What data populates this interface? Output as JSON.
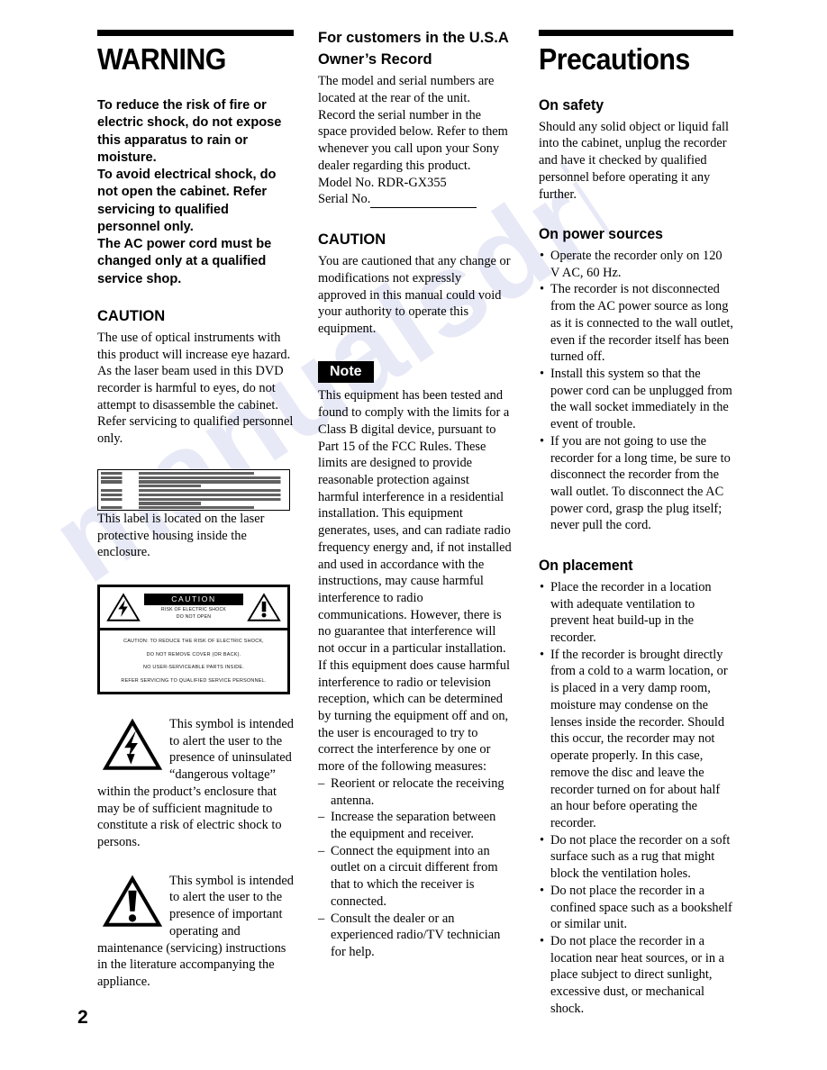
{
  "page": {
    "number": "2",
    "watermark_text": "manualsdrive.com"
  },
  "left_column": {
    "heading": "WARNING",
    "warning_paragraphs": [
      "To reduce the risk of fire or electric shock, do not expose this apparatus to rain or moisture.",
      "To avoid electrical shock, do not open the cabinet. Refer servicing to qualified personnel only.",
      "The AC power cord must be changed only at a qualified service shop."
    ],
    "caution_heading": "CAUTION",
    "caution_text": "The use of optical instruments with this product will increase eye hazard. As the laser beam used in this DVD recorder is harmful to eyes, do not attempt to disassemble the cabinet. Refer servicing to qualified personnel only.",
    "laser_label": {
      "left_terms": [
        "DANGER",
        "CAUTION",
        "VORSICHT",
        "ADVARSEL",
        "VARNING",
        "VARO!",
        "VARO!"
      ],
      "note": "Multilingual laser radiation warning label (text not legible at this resolution)"
    },
    "label_caption": "This label is located on the laser protective housing inside the enclosure.",
    "shock_box": {
      "caution_bar": "CAUTION",
      "caution_sub_line1": "RISK OF ELECTRIC SHOCK",
      "caution_sub_line2": "DO NOT OPEN",
      "lines": [
        "CAUTION: TO REDUCE THE RISK OF ELECTRIC SHOCK,",
        "DO NOT REMOVE COVER (OR BACK).",
        "NO USER-SERVICEABLE PARTS INSIDE.",
        "REFER SERVICING TO QUALIFIED SERVICE PERSONNEL."
      ]
    },
    "symbol_bolt_text": "This symbol is intended to alert the user to the presence of uninsulated “dangerous voltage” within the product’s enclosure that may be of sufficient magnitude to constitute a risk of electric shock to persons.",
    "symbol_excl_text": "This symbol is intended to alert the user to the presence of important operating and maintenance (servicing) instructions in the literature accompanying the appliance."
  },
  "middle_column": {
    "usa_heading_line1": "For customers in the U.S.A",
    "usa_heading_line2": "Owner’s Record",
    "owner_paragraphs": [
      "The model and serial numbers are located at the rear of the unit.",
      "Record the serial number in the space provided below. Refer to them whenever you call upon your Sony dealer regarding this product."
    ],
    "model_label": "Model No. RDR-GX355",
    "serial_label": "Serial No.",
    "caution_heading": "CAUTION",
    "caution_text": "You are cautioned that any change or modifications not expressly approved in this manual could void your authority to operate this equipment.",
    "note_badge": "Note",
    "note_text": "This equipment has been tested and found to comply with the limits for a Class B digital device, pursuant to Part 15 of the FCC Rules. These limits are designed to provide reasonable protection against harmful interference in a residential installation. This equipment generates, uses, and can radiate radio frequency energy and, if not installed and used in accordance with the instructions, may cause harmful interference to radio communications. However, there is no guarantee that interference will not occur in a particular installation. If this equipment does cause harmful interference to radio or television reception, which can be determined by turning the equipment off and on, the user is encouraged to try to correct the interference by one or more of the following measures:",
    "measures": [
      "Reorient or relocate the receiving antenna.",
      "Increase the separation between the equipment and receiver.",
      "Connect the equipment into an outlet on a circuit different from that to which the receiver is connected.",
      "Consult the dealer or an experienced radio/TV technician for help."
    ]
  },
  "right_column": {
    "heading": "Precautions",
    "on_safety": {
      "heading": "On safety",
      "text": "Should any solid object or liquid fall into the cabinet, unplug the recorder and have it checked by qualified personnel before operating it any further."
    },
    "on_power_sources": {
      "heading": "On power sources",
      "bullets": [
        "Operate the recorder only on 120 V AC, 60 Hz.",
        "The recorder is not disconnected from the AC power source as long as it is connected to the wall outlet, even if the recorder itself has been turned off.",
        "Install this system so that the power cord can be unplugged from the wall socket immediately in the event of trouble.",
        "If you are not going to use the recorder for a long time, be sure to disconnect the recorder from the wall outlet. To disconnect the AC power cord, grasp the plug itself; never pull the cord."
      ]
    },
    "on_placement": {
      "heading": "On placement",
      "bullets": [
        "Place the recorder in a location with adequate ventilation to prevent heat build-up in the recorder.",
        "If the recorder is brought directly from a cold to a warm location, or is placed in a very damp room, moisture may condense on the lenses inside the recorder. Should this occur, the recorder may not operate properly. In this case, remove the disc and leave the recorder turned on for about half an hour before operating the recorder.",
        "Do not place the recorder on a soft surface such as a rug that might block the ventilation holes.",
        "Do not place the recorder in a confined space such as a bookshelf or similar unit.",
        "Do not place the recorder in a location near heat sources, or in a place subject to direct sunlight, excessive dust, or mechanical shock."
      ]
    }
  },
  "colors": {
    "ink": "#000000",
    "paper": "#ffffff",
    "watermark": "#6976c4"
  }
}
